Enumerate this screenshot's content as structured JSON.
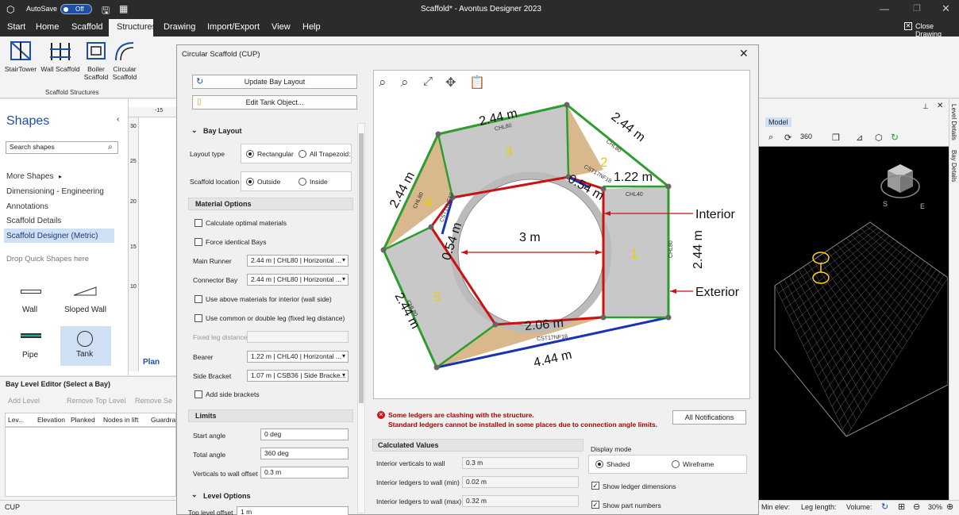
{
  "titlebar": {
    "autosave_label": "AutoSave",
    "autosave_state": "Off",
    "doc_title": "Scaffold* - Avontus Designer 2023"
  },
  "menu": {
    "items": [
      "Start",
      "Home",
      "Scaffold",
      "Structures",
      "Drawing",
      "Import/Export",
      "View",
      "Help"
    ],
    "close_drawing": "Close Drawing"
  },
  "ribbon": {
    "buttons": [
      {
        "label": "StairTower"
      },
      {
        "label": "Wall Scaffold"
      },
      {
        "label": "Boiler Scaffold"
      },
      {
        "label": "Circular Scaffold"
      }
    ],
    "group_label": "Scaffold Structures"
  },
  "shapes": {
    "title": "Shapes",
    "search_placeholder": "Search shapes",
    "items": [
      "More Shapes",
      "Dimensioning - Engineering",
      "Annotations",
      "Scaffold Details",
      "Scaffold Designer (Metric)"
    ],
    "drop_text": "Drop Quick Shapes here",
    "quick": [
      "Wall",
      "Sloped Wall",
      "Pipe",
      "Tank"
    ]
  },
  "drawing": {
    "ruler": [
      "-15",
      "30",
      "25",
      "20",
      "15",
      "10"
    ],
    "plan_tab": "Plan"
  },
  "bay_editor": {
    "title": "Bay Level Editor (Select a Bay)",
    "add": "Add Level",
    "remove_top": "Remove Top Level",
    "remove_sel": "Remove Se",
    "cols": [
      "Lev...",
      "Elevation",
      "Planked",
      "Nodes in lift",
      "Guardra"
    ]
  },
  "dialog": {
    "title": "Circular Scaffold (CUP)",
    "update_btn": "Update Bay Layout",
    "edit_btn": "Edit Tank Object...",
    "bay_layout": "Bay Layout",
    "layout_type": "Layout type",
    "rect": "Rectangular",
    "trap": "All Trapezoid:",
    "scaffold_loc": "Scaffold location",
    "outside": "Outside",
    "inside": "Inside",
    "material_options": "Material Options",
    "calc_opt": "Calculate optimal materials",
    "force": "Force identical Bays",
    "main_runner": "Main Runner",
    "main_runner_val": "2.44 m | CHL80 | Horizontal ...",
    "connector": "Connector Bay",
    "connector_val": "2.44 m | CHL80 | Horizontal ...",
    "use_above": "Use above materials for interior (wall side)",
    "use_common": "Use common or double leg (fixed leg distance)",
    "fixed_leg": "Fixed leg distance",
    "bearer": "Bearer",
    "bearer_val": "1.22 m | CHL40 | Horizontal ...",
    "side_bracket": "Side Bracket",
    "side_bracket_val": "1.07 m | CSB36 | Side Bracke...",
    "add_side": "Add side brackets",
    "limits": "Limits",
    "start_angle": "Start angle",
    "start_angle_val": "0 deg",
    "total_angle": "Total angle",
    "total_angle_val": "360 deg",
    "vert_offset": "Verticals to wall offset",
    "vert_offset_val": "0.3 m",
    "level_options": "Level Options",
    "top_level": "Top level offset",
    "top_level_val": "1 m",
    "warn1": "Some ledgers are clashing with the structure.",
    "warn2": "Standard ledgers cannot be installed in some places due to connection angle limits.",
    "all_notif": "All Notifications",
    "calc_values": "Calculated Values",
    "iv": "Interior verticals to wall",
    "iv_val": "0.3 m",
    "ilmin": "Interior ledgers to wall (min)",
    "ilmin_val": "0.02 m",
    "ilmax": "Interior ledgers to wall (max)",
    "ilmax_val": "0.32 m",
    "display_mode": "Display mode",
    "shaded": "Shaded",
    "wire": "Wireframe",
    "show_ledger": "Show ledger dimensions",
    "show_part": "Show part numbers"
  },
  "diagram": {
    "bays": [
      "1",
      "2",
      "3",
      "4",
      "5"
    ],
    "dims": [
      "2.44 m",
      "2.44 m",
      "1.22 m",
      "2.44 m",
      "2.44 m",
      "2.44 m",
      "4.44 m",
      "2.06 m",
      "3 m",
      "0.54 m",
      "0.54 m"
    ],
    "parts": [
      "CHL80",
      "CHL80",
      "CHL80",
      "CHL80",
      "CHL80",
      "CHL40",
      "CST17NF18",
      "CST17NF18",
      "CST17NF18"
    ],
    "interior": "Interior",
    "exterior": "Exterior"
  },
  "model": {
    "tab": "Model",
    "side1": "Level Details",
    "side2": "Bay Details",
    "cube": "TOP"
  },
  "status": {
    "left": "CUP",
    "min_elev": "Min elev:",
    "leg_length": "Leg length:",
    "volume": "Volume:",
    "zoom": "30%"
  },
  "colors": {
    "dark": "#2b2b2b",
    "green": "#2d9e2d",
    "red": "#cc1111",
    "blue": "#1a33b3",
    "tan": "#d8b88c",
    "gray": "#c8c8c8",
    "warn": "#b00000",
    "accent": "#1e4fa8"
  }
}
